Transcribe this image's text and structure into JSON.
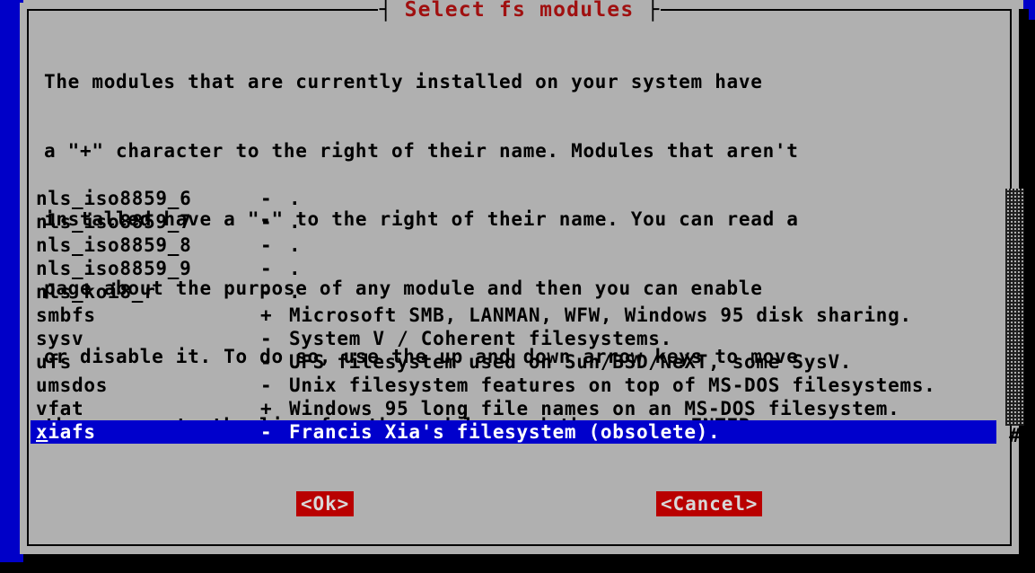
{
  "window": {
    "title": "Select fs modules",
    "title_left_bar": "┤",
    "title_right_bar": "├"
  },
  "prose": {
    "lines": [
      "The modules that are currently installed on your system have",
      "a \"+\" character to the right of their name. Modules that aren't",
      "installed have a \"-\" to the right of their name. You can read a",
      "page about the purpose of any module and then you can enable",
      "or disable it. To do so, use the up and down arrow keys to move",
      "the cursor to the line for the module, and then press ENTER."
    ]
  },
  "list": {
    "items": [
      {
        "name": "nls_iso8859_6",
        "flag": "-",
        "desc": ".",
        "selected": false
      },
      {
        "name": "nls_iso8859_7",
        "flag": "-",
        "desc": ".",
        "selected": false
      },
      {
        "name": "nls_iso8859_8",
        "flag": "-",
        "desc": ".",
        "selected": false
      },
      {
        "name": "nls_iso8859_9",
        "flag": "-",
        "desc": ".",
        "selected": false
      },
      {
        "name": "nls_koi8_r",
        "flag": "-",
        "desc": ".",
        "selected": false
      },
      {
        "name": "smbfs",
        "flag": "+",
        "desc": "Microsoft SMB, LANMAN, WFW, Windows 95 disk sharing.",
        "selected": false
      },
      {
        "name": "sysv",
        "flag": "-",
        "desc": "System V / Coherent filesystems.",
        "selected": false
      },
      {
        "name": "ufs",
        "flag": "-",
        "desc": "UFS filesystem used on Sun/BSD/NeXT, some SysV.",
        "selected": false
      },
      {
        "name": "umsdos",
        "flag": "-",
        "desc": "Unix filesystem features on top of MS-DOS filesystems.",
        "selected": false
      },
      {
        "name": "vfat",
        "flag": "+",
        "desc": "Windows 95 long file names on an MS-DOS filesystem.",
        "selected": false
      },
      {
        "name": "xiafs",
        "flag": "-",
        "desc": "Francis Xia's filesystem (obsolete).",
        "selected": true,
        "hotkey": "x",
        "rest": "iafs"
      }
    ]
  },
  "scrollbar": {
    "thumb_glyph": "#"
  },
  "buttons": {
    "ok": "<Ok>",
    "cancel": "<Cancel>"
  },
  "colors": {
    "dialog_bg": "#b0b0b0",
    "desktop_blue": "#0000c8",
    "title_red": "#a01010",
    "button_red": "#b90000",
    "highlight_blue": "#0000cc",
    "text_black": "#000000"
  }
}
